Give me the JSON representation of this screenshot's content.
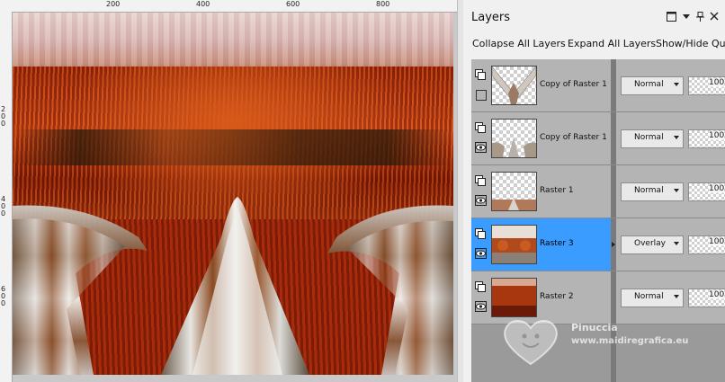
{
  "ruler": {
    "top_labels": [
      "200",
      "400",
      "600",
      "800"
    ],
    "left_labels": [
      "2\n0\n0",
      "4\n0\n0",
      "6\n0\n0"
    ]
  },
  "panel": {
    "title": "Layers",
    "icons": [
      "maximize-icon",
      "dropdown-icon",
      "pin-icon",
      "close-icon"
    ]
  },
  "toolbar": {
    "collapse_label": "Collapse All Layers",
    "expand_label": "Expand All Layers",
    "showhide_label": "Show/Hide Qu"
  },
  "layers": [
    {
      "name": "Copy of Raster 1",
      "blend": "Normal",
      "opacity": "100",
      "visibility": "hidden",
      "selected": false
    },
    {
      "name": "Copy of Raster 1",
      "blend": "Normal",
      "opacity": "100",
      "visibility": "visible",
      "selected": false
    },
    {
      "name": "Raster 1",
      "blend": "Normal",
      "opacity": "100",
      "visibility": "visible",
      "selected": false
    },
    {
      "name": "Raster 3",
      "blend": "Overlay",
      "opacity": "100",
      "visibility": "visible",
      "selected": true
    },
    {
      "name": "Raster 2",
      "blend": "Normal",
      "opacity": "100",
      "visibility": "visible",
      "selected": false
    }
  ],
  "watermark": {
    "name": "Pinuccia",
    "url": "www.maidiregrafica.eu"
  },
  "colors": {
    "selection": "#3b9cff",
    "panel_bg": "#f0f0f0",
    "row_bg": "#b4b4b4"
  }
}
